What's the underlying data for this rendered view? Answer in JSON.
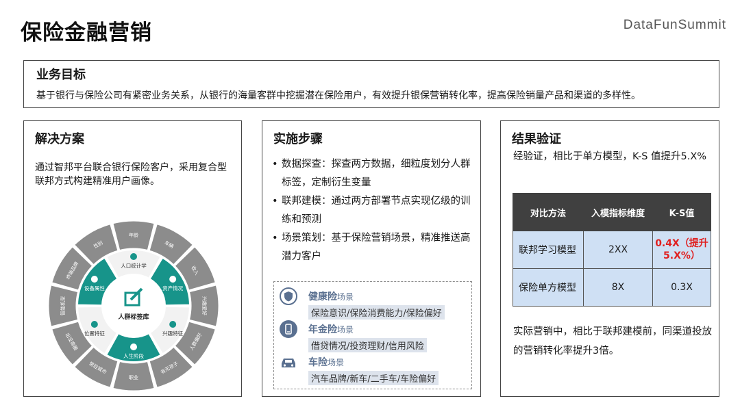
{
  "page": {
    "title": "保险金融营销",
    "brand": "DataFunSummit"
  },
  "goal": {
    "heading": "业务目标",
    "text": "基于银行与保险公司有紧密业务关系，从银行的海量客群中挖掘潜在保险用户，有效提升银保营销转化率，提高保险销量产品和渠道的多样性。"
  },
  "solution": {
    "heading": "解决方案",
    "text": "通过智邦平台联合银行保险客户，采用复合型联邦方式构建精准用户画像。",
    "wheel": {
      "center": "人群标签库",
      "inner": [
        "人口统计学",
        "资产情况",
        "兴趣特征",
        "人生阶段",
        "位置特征",
        "设备属性"
      ],
      "outer": [
        "性别",
        "年龄",
        "车辆",
        "收入",
        "兴趣爱好",
        "人群偏好",
        "有无孩子",
        "职业",
        "常驻城市",
        "出没商圈",
        "智能机型",
        "终端品牌"
      ]
    }
  },
  "steps": {
    "heading": "实施步骤",
    "items": [
      "数据探查：探查两方数据，细粒度划分人群标签，定制衍生变量",
      "联邦建模：通过两方部署节点实现亿级的训练和预测",
      "场景策划：基于保险营销场景，精准推送高潜力客户"
    ],
    "scenarios": [
      {
        "icon": "shield-icon",
        "title": "健康险",
        "suffix": "场景",
        "sub": "保险意识/保险消费能力/保险偏好"
      },
      {
        "icon": "phone-icon",
        "title": "年金险",
        "suffix": "场景",
        "sub": "借贷情况/投资理财/信用风险"
      },
      {
        "icon": "car-icon",
        "title": "车险",
        "suffix": "场景",
        "sub": "汽车品牌/新车/二手车/车险偏好"
      }
    ]
  },
  "results": {
    "heading": "结果验证",
    "text1": "经验证，相比于单方模型，K-S 值提升5.X%",
    "table": {
      "headers": [
        "对比方法",
        "入模指标维度",
        "K-S值"
      ],
      "rows": [
        [
          "联邦学习模型",
          "2XX",
          "0.4X（提升5.X%）"
        ],
        [
          "保险单方模型",
          "8X",
          "0.3X"
        ]
      ]
    },
    "text2": "实际营销中，相比于联邦建模前，同渠道投放的营销转化率提升3倍。"
  },
  "colors": {
    "teal": "#17948a",
    "gray": "#8c8c8c",
    "highlight": "#e02020",
    "table_header": "#404040",
    "table_cell": "#cfe0f4"
  }
}
